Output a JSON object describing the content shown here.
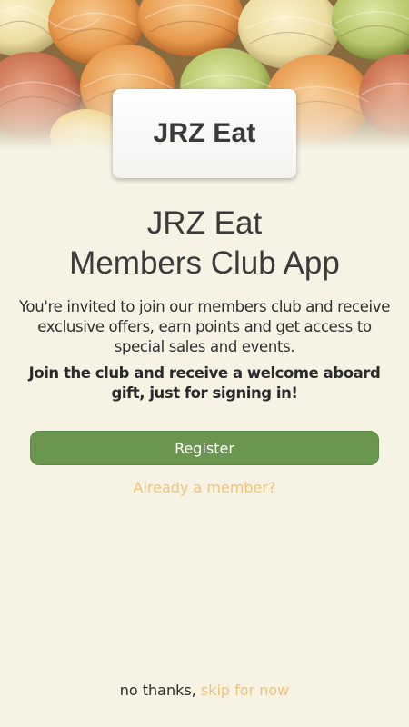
{
  "header": {
    "logo_text": "JRZ Eat"
  },
  "main": {
    "title_line1": "JRZ Eat",
    "title_line2": "Members Club App",
    "intro": "You're invited to join our members club and receive exclusive offers, earn points and get access to special sales and events.",
    "promo": "Join the club and receive a welcome aboard gift, just for signing in!",
    "register_label": "Register",
    "member_link": "Already a member?"
  },
  "footer": {
    "prefix": "no thanks,",
    "skip_label": "skip for now"
  },
  "colors": {
    "background": "#f6f3e5",
    "primary_button": "#6a964f",
    "link": "#f0c27a",
    "text": "#3b3b3b"
  },
  "icons": {
    "hero": "pasta-nests-image"
  }
}
